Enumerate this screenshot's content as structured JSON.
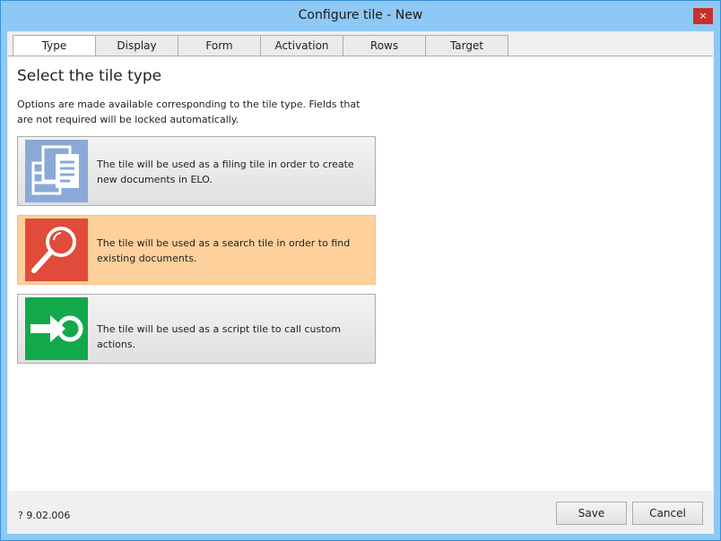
{
  "window": {
    "title": "Configure tile - New",
    "close_glyph": "×"
  },
  "tabs": [
    {
      "label": "Type"
    },
    {
      "label": "Display"
    },
    {
      "label": "Form"
    },
    {
      "label": "Activation"
    },
    {
      "label": "Rows"
    },
    {
      "label": "Target"
    }
  ],
  "active_tab": "Type",
  "panel": {
    "heading": "Select the tile type",
    "description": "Options are made available corresponding to the tile type. Fields that are not required will be locked automatically."
  },
  "options": [
    {
      "text": "The tile will be used as a filing tile in order to create new documents in ELO.",
      "icon": "filing-icon",
      "color": "#8aa9d6",
      "selected": false
    },
    {
      "text": "The tile will be used as a search tile in order to find existing documents.",
      "icon": "search-icon",
      "color": "#e04b3a",
      "selected": true
    },
    {
      "text": "The tile will be used as a script tile to call custom actions.",
      "icon": "script-arrow-icon",
      "color": "#12a94a",
      "selected": false
    }
  ],
  "footer": {
    "version": "? 9.02.006",
    "save_label": "Save",
    "cancel_label": "Cancel"
  }
}
